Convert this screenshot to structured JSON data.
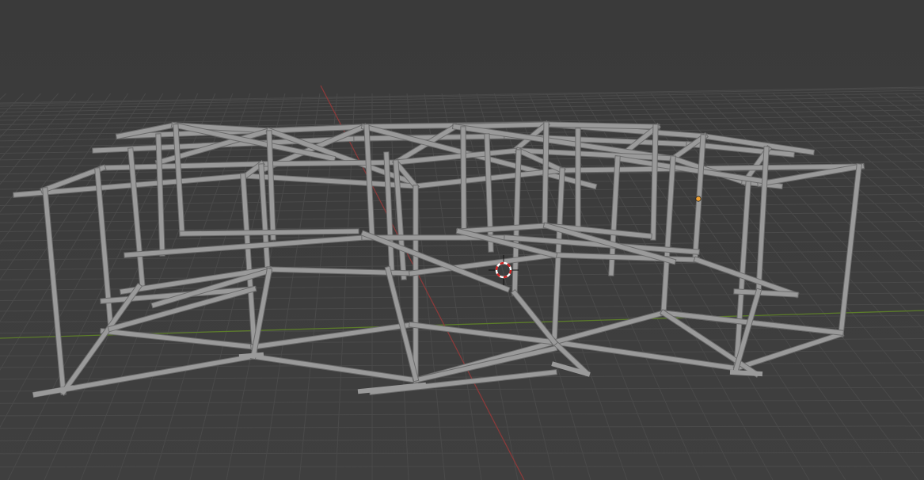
{
  "viewport": {
    "mode": "3d-viewport",
    "background": "#3d3d3d",
    "grid_color": "#4a4a4a",
    "axis_x_color": "#8a3a3a",
    "axis_y_color": "#5c7c2a",
    "object_color": "#9a9a9a",
    "object_edge_color": "#6c6c6c",
    "origin_color": "#f0a030",
    "cursor_primary_color": "#d22222",
    "cursor_secondary_color": "#ffffff",
    "icons": {
      "cursor": "3d-cursor-icon",
      "origin": "object-origin-icon"
    }
  }
}
